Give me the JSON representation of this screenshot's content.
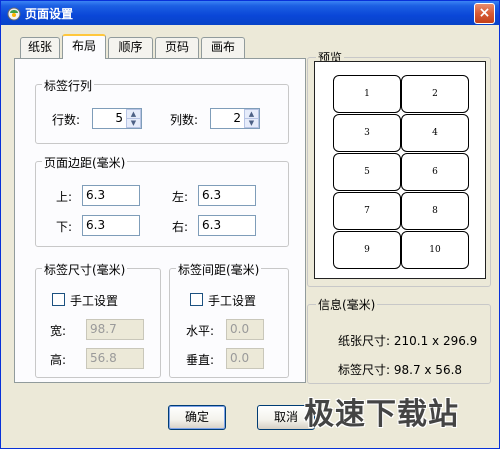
{
  "window": {
    "title": "页面设置",
    "close_label": "×"
  },
  "tabs": [
    {
      "label": "纸张",
      "active": false
    },
    {
      "label": "布局",
      "active": true
    },
    {
      "label": "顺序",
      "active": false
    },
    {
      "label": "页码",
      "active": false
    },
    {
      "label": "画布",
      "active": false
    }
  ],
  "label_rows_cols": {
    "title": "标签行列",
    "rows_label": "行数:",
    "rows_value": "5",
    "cols_label": "列数:",
    "cols_value": "2"
  },
  "margins": {
    "title": "页面边距(毫米)",
    "top_label": "上:",
    "top_value": "6.3",
    "left_label": "左:",
    "left_value": "6.3",
    "bottom_label": "下:",
    "bottom_value": "6.3",
    "right_label": "右:",
    "right_value": "6.3"
  },
  "label_size": {
    "title": "标签尺寸(毫米)",
    "manual_label": "手工设置",
    "width_label": "宽:",
    "width_value": "98.7",
    "height_label": "高:",
    "height_value": "56.8"
  },
  "label_spacing": {
    "title": "标签间距(毫米)",
    "manual_label": "手工设置",
    "horizontal_label": "水平:",
    "horizontal_value": "0.0",
    "vertical_label": "垂直:",
    "vertical_value": "0.0"
  },
  "preview": {
    "title": "预览",
    "cells": [
      "1",
      "2",
      "3",
      "4",
      "5",
      "6",
      "7",
      "8",
      "9",
      "10"
    ]
  },
  "info": {
    "title": "信息(毫米)",
    "paper_size": "纸张尺寸: 210.1 x 296.9",
    "label_size": "标签尺寸: 98.7 x 56.8"
  },
  "buttons": {
    "ok": "确定",
    "cancel": "取消"
  },
  "watermark": "极速下载站",
  "spin_glyphs": {
    "up": "▲",
    "down": "▼"
  }
}
